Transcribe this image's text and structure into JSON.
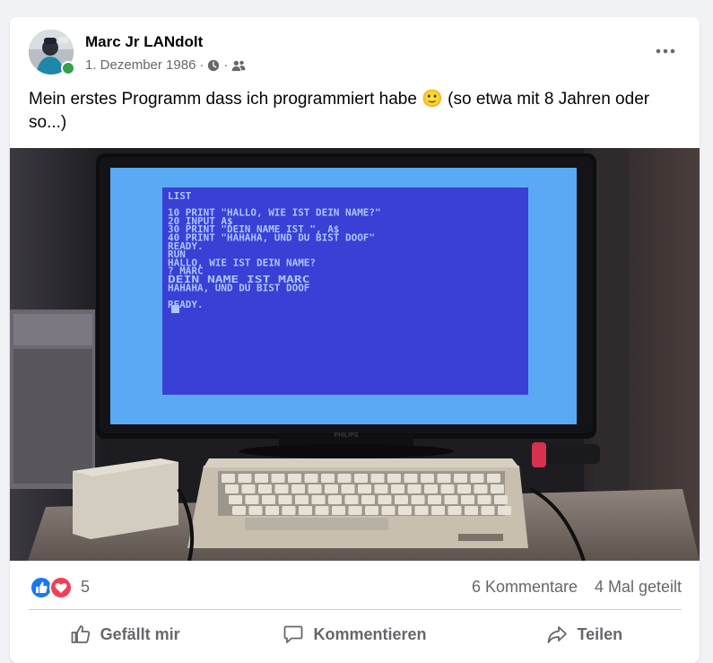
{
  "post": {
    "author": "Marc Jr LANdolt",
    "date": "1. Dezember 1986",
    "text": "Mein erstes Programm dass ich programmiert habe 🙂 (so etwa mit 8 Jahren oder so...)",
    "icons": {
      "privacy": "clock-icon",
      "audience": "friends-icon",
      "more": "more-options-icon"
    },
    "image": {
      "description_source": "photo",
      "screen_lines": [
        "LIST",
        "",
        "10 PRINT \"HALLO, WIE IST DEIN NAME?\"",
        "20 INPUT A$",
        "30 PRINT \"DEIN NAME IST \", A$",
        "40 PRINT \"HAHAHA, UND DU BIST DOOF\"",
        "READY.",
        "RUN",
        "HALLO, WIE IST DEIN NAME?",
        "? MARC",
        "DEIN NAME IST       MARC",
        "HAHAHA, UND DU BIST DOOF",
        "",
        "READY."
      ],
      "monitor_brand": "PHILIPS"
    }
  },
  "stats": {
    "reactions": "5",
    "comments": "6 Kommentare",
    "shares": "4 Mal geteilt"
  },
  "actions": {
    "like": "Gefällt mir",
    "comment": "Kommentieren",
    "share": "Teilen"
  },
  "colors": {
    "like_blue": "#1877f2",
    "love_red": "#f33e58",
    "c64_blue": "#3a3fd6",
    "c64_border": "#5aa9f5",
    "c64_text": "#a9c7ff"
  }
}
